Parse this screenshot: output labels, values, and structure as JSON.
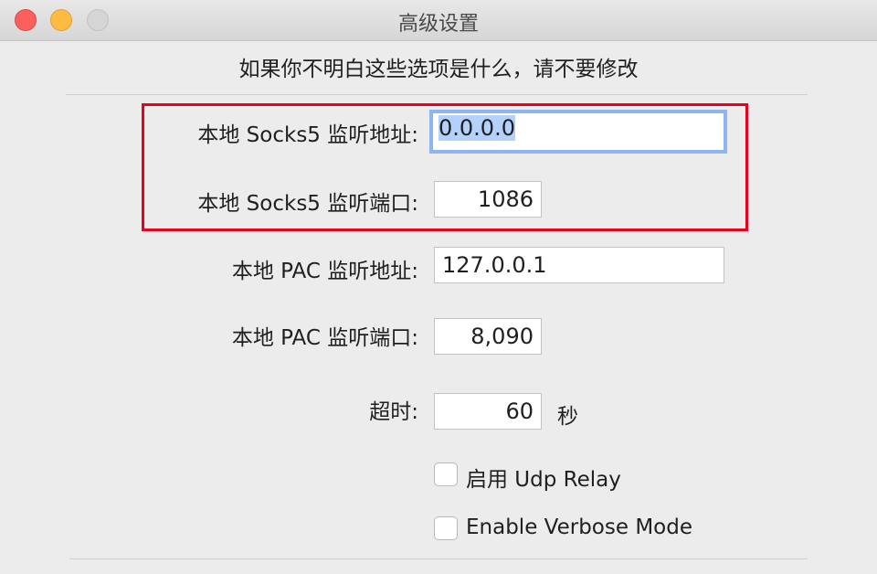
{
  "window": {
    "title": "高级设置"
  },
  "notice": "如果你不明白这些选项是什么，请不要修改",
  "fields": {
    "socks5_address": {
      "label": "本地 Socks5 监听地址:",
      "value": "0.0.0.0"
    },
    "socks5_port": {
      "label": "本地 Socks5 监听端口:",
      "value": "1086"
    },
    "pac_address": {
      "label": "本地 PAC 监听地址:",
      "value": "127.0.0.1"
    },
    "pac_port": {
      "label": "本地 PAC 监听端口:",
      "value": "8,090"
    },
    "timeout": {
      "label": "超时:",
      "value": "60",
      "unit": "秒"
    }
  },
  "options": {
    "udp_relay": {
      "label": "启用 Udp Relay",
      "checked": false
    },
    "verbose_mode": {
      "label": "Enable Verbose Mode",
      "checked": false
    }
  },
  "colors": {
    "highlight_box": "#e8001c",
    "focus_ring": "#8fb5f1",
    "selection": "#b3d1fb"
  }
}
